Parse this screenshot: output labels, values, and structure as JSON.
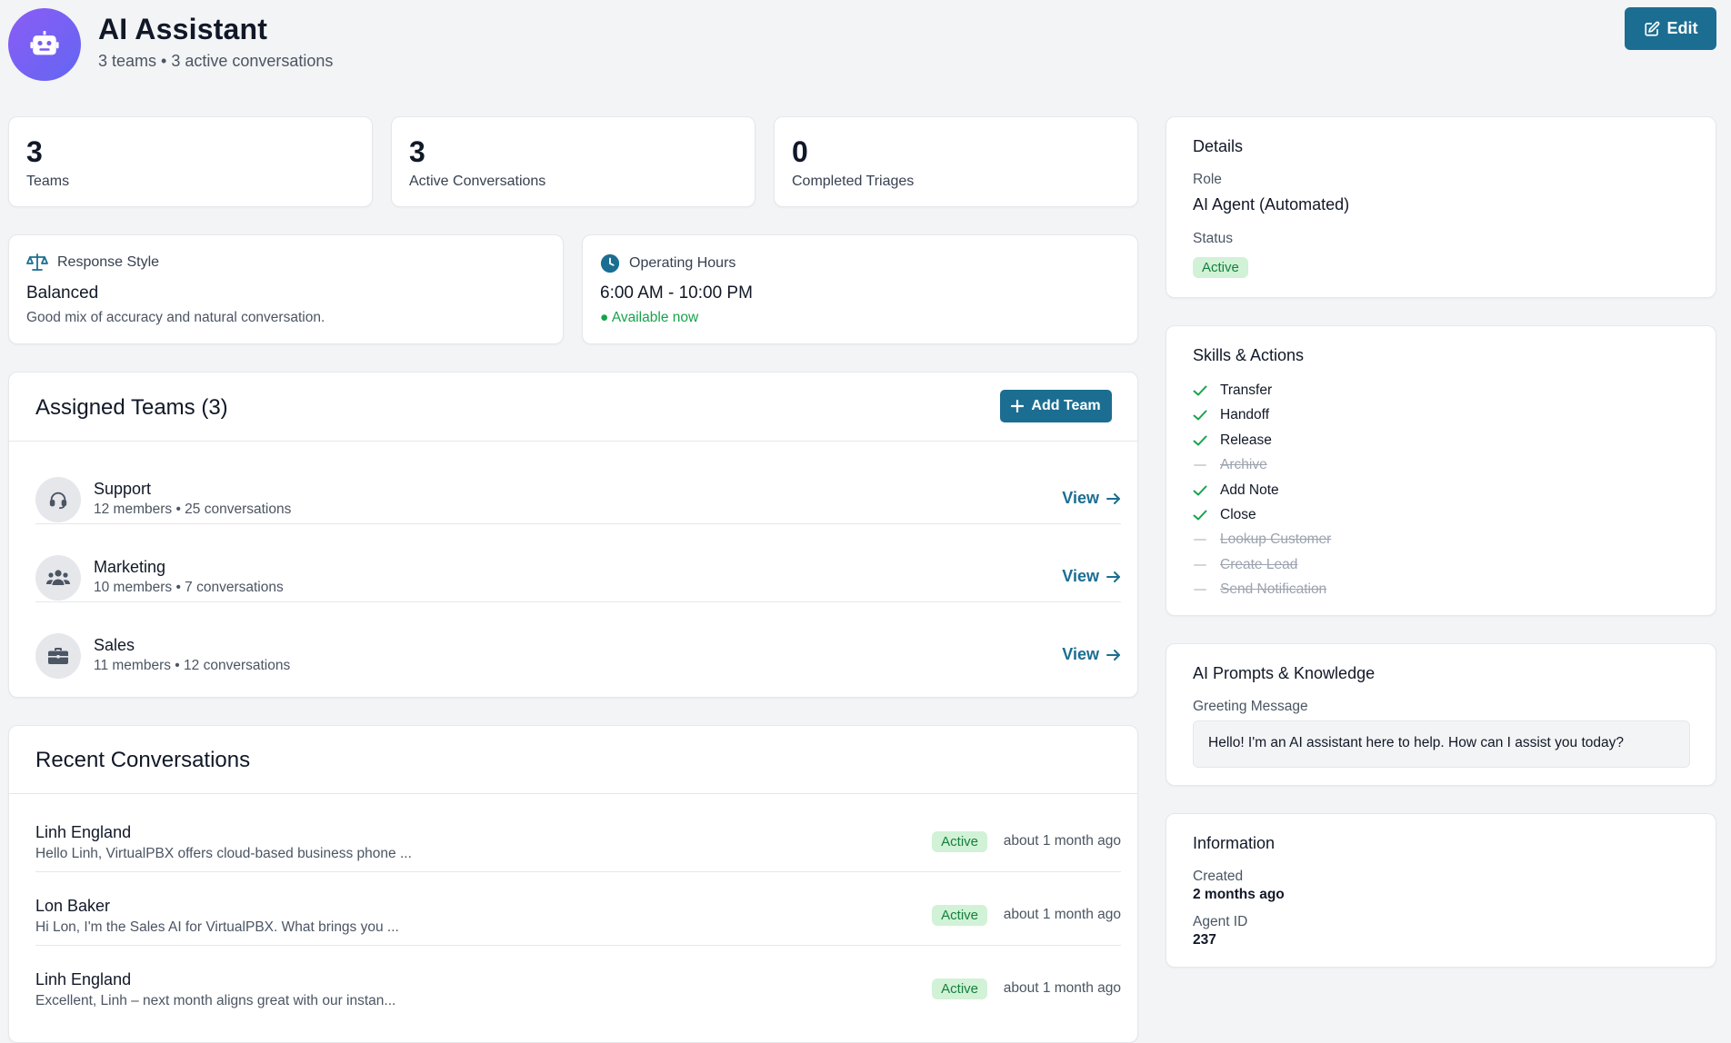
{
  "header": {
    "title": "AI Assistant",
    "subtitle": "3 teams • 3 active conversations",
    "edit_label": "Edit",
    "avatar_icon": "robot-icon",
    "avatar_colors": [
      "#8b5cf6",
      "#6366f1"
    ]
  },
  "stats": [
    {
      "value": "3",
      "label": "Teams"
    },
    {
      "value": "3",
      "label": "Active Conversations"
    },
    {
      "value": "0",
      "label": "Completed Triages"
    }
  ],
  "response_style": {
    "heading": "Response Style",
    "value": "Balanced",
    "description": "Good mix of accuracy and natural conversation.",
    "icon": "scale-icon"
  },
  "operating_hours": {
    "heading": "Operating Hours",
    "value": "6:00 AM - 10:00 PM",
    "status": "● Available now",
    "icon": "clock-icon"
  },
  "teams": {
    "title": "Assigned Teams (3)",
    "add_label": "Add Team",
    "items": [
      {
        "name": "Support",
        "meta": "12 members • 25 conversations",
        "view": "View",
        "icon": "headset-icon"
      },
      {
        "name": "Marketing",
        "meta": "10 members • 7 conversations",
        "view": "View",
        "icon": "users-icon"
      },
      {
        "name": "Sales",
        "meta": "11 members • 12 conversations",
        "view": "View",
        "icon": "briefcase-icon"
      }
    ]
  },
  "conversations": {
    "title": "Recent Conversations",
    "items": [
      {
        "name": "Linh England",
        "preview": "Hello Linh, VirtualPBX offers cloud-based business phone ...",
        "status": "Active",
        "time": "about 1 month ago"
      },
      {
        "name": "Lon Baker",
        "preview": "Hi Lon, I'm the Sales AI for VirtualPBX. What brings you ...",
        "status": "Active",
        "time": "about 1 month ago"
      },
      {
        "name": "Linh England",
        "preview": "Excellent, Linh – next month aligns great with our instan...",
        "status": "Active",
        "time": "about 1 month ago"
      }
    ]
  },
  "details": {
    "title": "Details",
    "role_label": "Role",
    "role_value": "AI Agent (Automated)",
    "status_label": "Status",
    "status_value": "Active"
  },
  "skills": {
    "title": "Skills & Actions",
    "items": [
      {
        "label": "Transfer",
        "enabled": true
      },
      {
        "label": "Handoff",
        "enabled": true
      },
      {
        "label": "Release",
        "enabled": true
      },
      {
        "label": "Archive",
        "enabled": false
      },
      {
        "label": "Add Note",
        "enabled": true
      },
      {
        "label": "Close",
        "enabled": true
      },
      {
        "label": "Lookup Customer",
        "enabled": false
      },
      {
        "label": "Create Lead",
        "enabled": false
      },
      {
        "label": "Send Notification",
        "enabled": false
      }
    ]
  },
  "prompts": {
    "title": "AI Prompts & Knowledge",
    "greeting_label": "Greeting Message",
    "greeting_value": "Hello! I'm an AI assistant here to help. How can I assist you today?"
  },
  "information": {
    "title": "Information",
    "created_label": "Created",
    "created_value": "2 months ago",
    "agent_id_label": "Agent ID",
    "agent_id_value": "237"
  },
  "colors": {
    "primary": "#1b6e92",
    "success_bg": "#d1f2d6",
    "success_text": "#15803d",
    "check": "#16a34a"
  }
}
